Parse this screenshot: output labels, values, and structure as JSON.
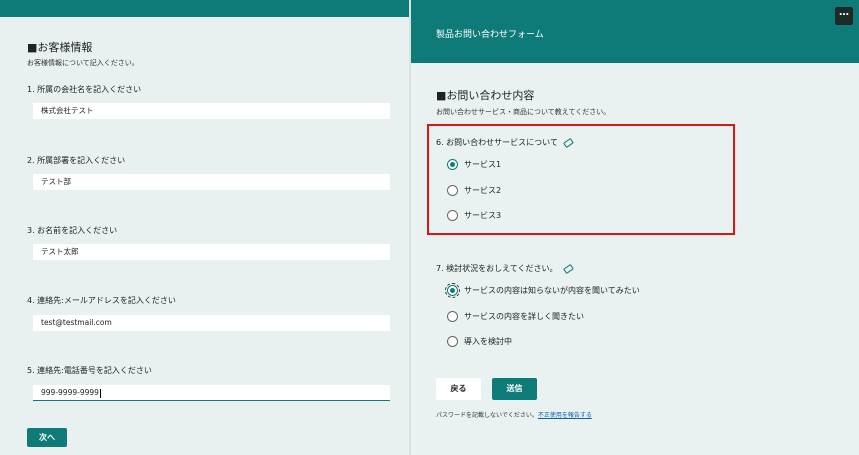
{
  "left": {
    "section_title": "■お客様情報",
    "section_desc": "お客様情報について記入ください。",
    "questions": [
      {
        "label": "1. 所属の会社名を記入ください",
        "value": "株式会社テスト"
      },
      {
        "label": "2. 所属部署を記入ください",
        "value": "テスト部"
      },
      {
        "label": "3. お名前を記入ください",
        "value": "テスト太郎"
      },
      {
        "label": "4. 連絡先:メールアドレスを記入ください",
        "value": "test@testmail.com"
      },
      {
        "label": "5. 連絡先:電話番号を記入ください",
        "value": "999-9999-9999"
      }
    ],
    "next_label": "次へ"
  },
  "right": {
    "form_title": "製品お問い合わせフォーム",
    "more_label": "…",
    "section_title": "■お問い合わせ内容",
    "section_desc": "お問い合わせサービス・商品について教えてください。",
    "q6": {
      "label": "6. お問い合わせサービスについて",
      "options": [
        "サービス1",
        "サービス2",
        "サービス3"
      ],
      "selected": 0
    },
    "q7": {
      "label": "7. 検討状況をおしえてください。",
      "options": [
        "サービスの内容は知らないが内容を聞いてみたい",
        "サービスの内容を詳しく聞きたい",
        "導入を検討中"
      ],
      "selected": 0
    },
    "back_label": "戻る",
    "submit_label": "送信",
    "footer_text": "パスワードを記載しないでください。",
    "footer_link": "不正使用を報告する"
  },
  "colors": {
    "accent": "#0e7b78",
    "highlight": "#d9161b"
  }
}
